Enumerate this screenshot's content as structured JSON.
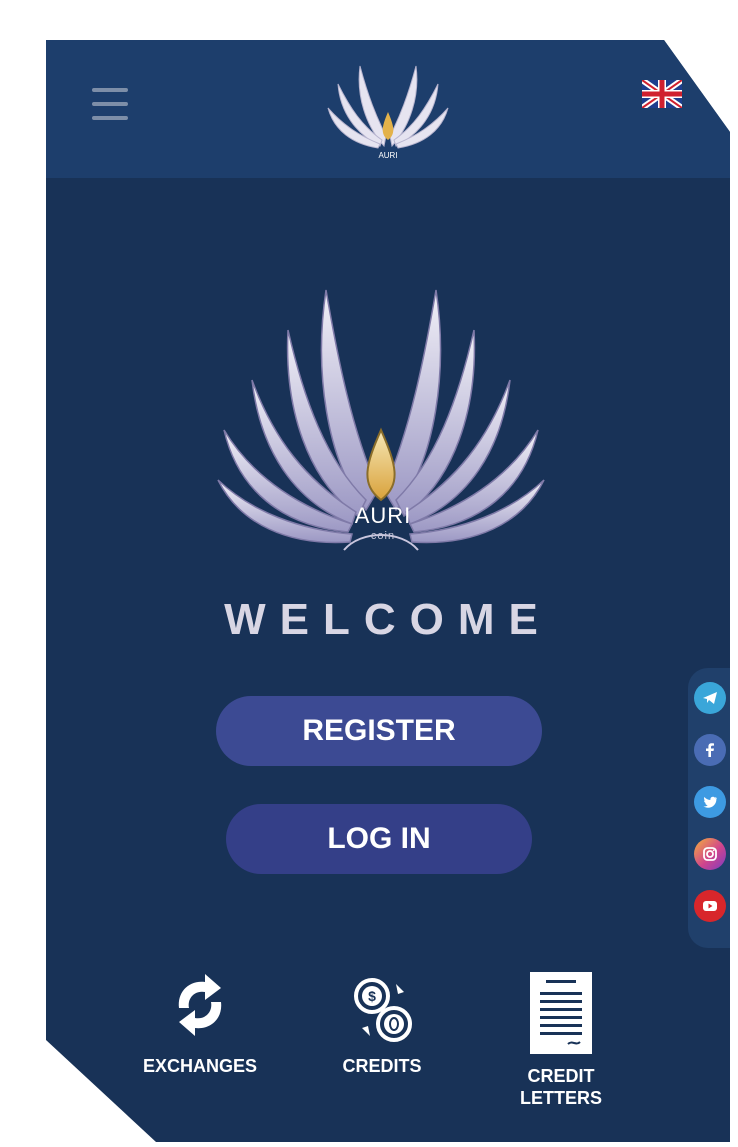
{
  "header": {
    "menu_icon": "hamburger-menu-icon",
    "logo": "auri-coin-logo",
    "language_flag": "uk-flag-icon"
  },
  "brand": {
    "name": "AURI",
    "sub": "coin"
  },
  "welcome": "WELCOME",
  "buttons": {
    "register": "REGISTER",
    "login": "LOG IN"
  },
  "social": [
    {
      "name": "telegram-icon",
      "color": "#3aa6d9"
    },
    {
      "name": "facebook-icon",
      "color": "#4a6cb4"
    },
    {
      "name": "twitter-icon",
      "color": "#3d9ae2"
    },
    {
      "name": "instagram-icon",
      "color": "#d0458d"
    },
    {
      "name": "youtube-icon",
      "color": "#d8262b"
    }
  ],
  "bottom_nav": {
    "exchanges": "EXCHANGES",
    "credits": "CREDITS",
    "credit_letters_line1": "CREDIT",
    "credit_letters_line2": "LETTERS"
  },
  "colors": {
    "background": "#183257",
    "header": "#1d3e6c",
    "button": "#3c4a93"
  }
}
